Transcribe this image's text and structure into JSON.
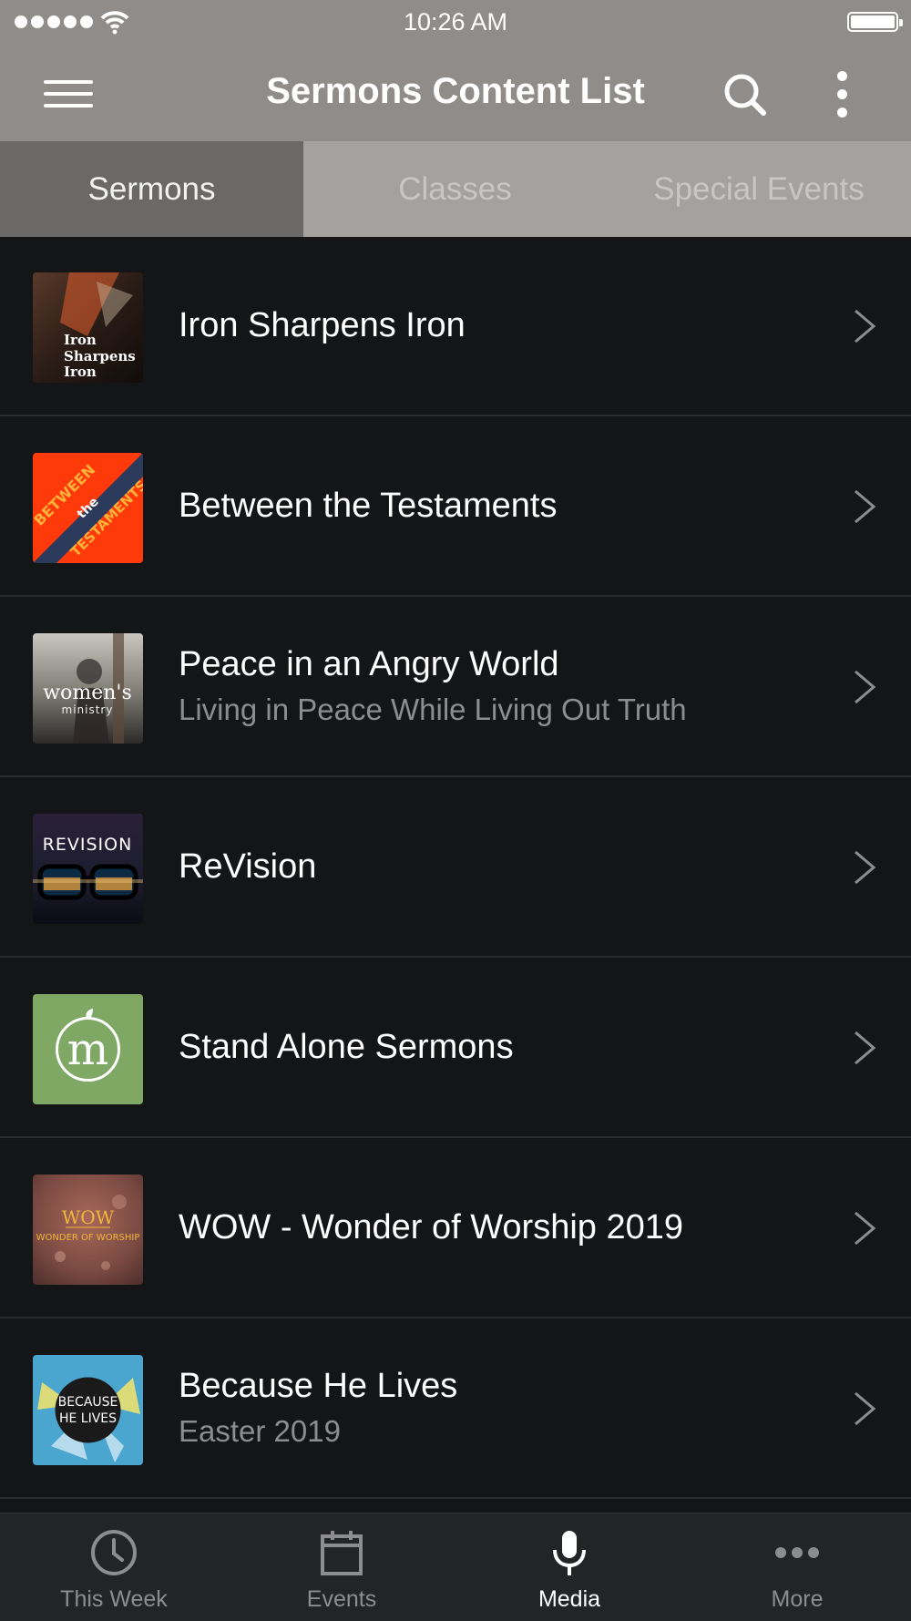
{
  "status_bar": {
    "time": "10:26 AM"
  },
  "header": {
    "title": "Sermons Content List"
  },
  "tabs": [
    {
      "label": "Sermons",
      "active": true
    },
    {
      "label": "Classes",
      "active": false
    },
    {
      "label": "Special Events",
      "active": false
    }
  ],
  "items": [
    {
      "title": "Iron Sharpens Iron",
      "subtitle": "",
      "thumb_text": "Iron Sharpens Iron"
    },
    {
      "title": "Between the Testaments",
      "subtitle": "",
      "thumb_text": "BETWEEN the TESTAMENTS"
    },
    {
      "title": "Peace in an Angry World",
      "subtitle": "Living in Peace While Living Out Truth",
      "thumb_text": "women's ministry"
    },
    {
      "title": "ReVision",
      "subtitle": "",
      "thumb_text": "REVISION"
    },
    {
      "title": "Stand Alone Sermons",
      "subtitle": "",
      "thumb_text": "m"
    },
    {
      "title": "WOW - Wonder of Worship 2019",
      "subtitle": "",
      "thumb_text": "WOW WONDER OF WORSHIP"
    },
    {
      "title": "Because He Lives",
      "subtitle": "Easter 2019",
      "thumb_text": "BECAUSE HE LIVES"
    }
  ],
  "bottom_nav": [
    {
      "label": "This Week",
      "icon": "clock-icon",
      "active": false
    },
    {
      "label": "Events",
      "icon": "calendar-icon",
      "active": false
    },
    {
      "label": "Media",
      "icon": "microphone-icon",
      "active": true
    },
    {
      "label": "More",
      "icon": "more-dots-icon",
      "active": false
    }
  ],
  "colors": {
    "header_bg": "#8f8c89",
    "list_bg": "#141517",
    "active_tab_bg": "#6a6967",
    "tabbar_bg": "#232426"
  }
}
